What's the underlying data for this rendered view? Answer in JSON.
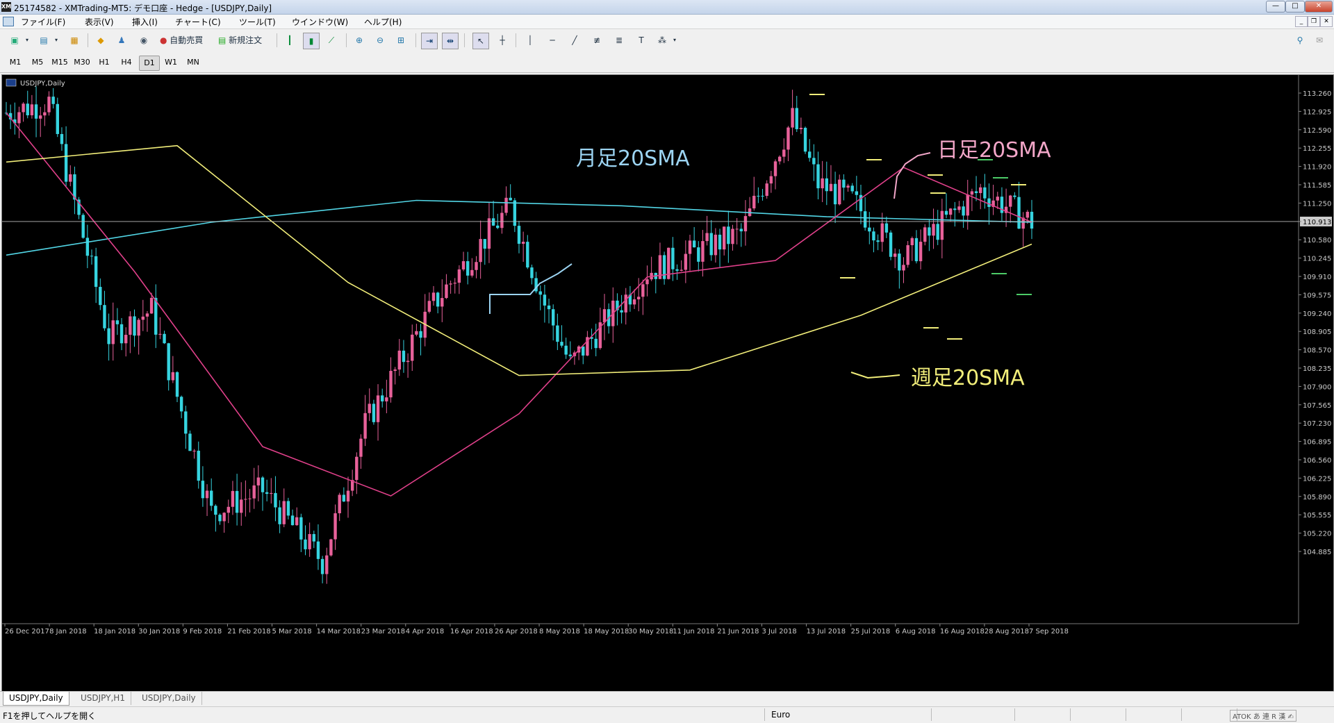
{
  "window": {
    "title": "25174582 - XMTrading-MT5: デモ口座 - Hedge - [USDJPY,Daily]",
    "logo": "XM",
    "controls": [
      "—",
      "□",
      "✕"
    ]
  },
  "menu": [
    "ファイル(F)",
    "表示(V)",
    "挿入(I)",
    "チャート(C)",
    "ツール(T)",
    "ウインドウ(W)",
    "ヘルプ(H)"
  ],
  "toolbar": {
    "auto_trade": "自動売買",
    "new_order": "新規注文"
  },
  "timeframes": [
    "M1",
    "M5",
    "M15",
    "M30",
    "H1",
    "H4",
    "D1",
    "W1",
    "MN"
  ],
  "active_timeframe": "D1",
  "chart": {
    "symbol_label": "USDJPY,Daily",
    "current_price": "110.913",
    "price_ticks": [
      "113.260",
      "112.925",
      "112.590",
      "112.255",
      "111.920",
      "111.585",
      "111.250",
      "110.913",
      "110.580",
      "110.245",
      "109.910",
      "109.575",
      "109.240",
      "108.905",
      "108.570",
      "108.235",
      "107.900",
      "107.565",
      "107.230",
      "106.895",
      "106.560",
      "106.225",
      "105.890",
      "105.555",
      "105.220",
      "104.885"
    ],
    "date_ticks": [
      "26 Dec 2017",
      "8 Jan 2018",
      "18 Jan 2018",
      "30 Jan 2018",
      "9 Feb 2018",
      "21 Feb 2018",
      "5 Mar 2018",
      "14 Mar 2018",
      "23 Mar 2018",
      "4 Apr 2018",
      "16 Apr 2018",
      "26 Apr 2018",
      "8 May 2018",
      "18 May 2018",
      "30 May 2018",
      "11 Jun 2018",
      "21 Jun 2018",
      "3 Jul 2018",
      "13 Jul 2018",
      "25 Jul 2018",
      "6 Aug 2018",
      "16 Aug 2018",
      "28 Aug 2018",
      "7 Sep 2018"
    ],
    "annotations": {
      "monthly": "月足20SMA",
      "daily": "日足20SMA",
      "weekly": "週足20SMA"
    },
    "colors": {
      "background": "#000000",
      "bull": "#e8619a",
      "bear": "#36d4e0",
      "sma_daily": "#e0408a",
      "sma_weekly": "#f2ee7a",
      "sma_monthly": "#52d6e6",
      "ann_monthly": "#9cd4f2",
      "ann_daily": "#f2a6c8",
      "ann_weekly": "#f2ee7a"
    }
  },
  "chart_data": {
    "type": "candlestick",
    "title": "USDJPY,Daily",
    "x_range": [
      "26 Dec 2017",
      "7 Sep 2018"
    ],
    "ylim": [
      104.7,
      113.4
    ],
    "current_price": 110.913,
    "key_points": [
      {
        "date": "8 Jan 2018",
        "close": 113.1
      },
      {
        "date": "30 Jan 2018",
        "close": 108.8
      },
      {
        "date": "26 Mar 2018",
        "low": 104.64
      },
      {
        "date": "21 May 2018",
        "high": 111.4
      },
      {
        "date": "29 May 2018",
        "low": 108.1
      },
      {
        "date": "19 Jul 2018",
        "high": 113.18
      },
      {
        "date": "21 Aug 2018",
        "low": 109.77
      },
      {
        "date": "7 Sep 2018",
        "close": 110.913
      }
    ],
    "series": [
      {
        "name": "月足20SMA",
        "values": [
          110.3,
          110.9,
          111.3,
          111.2,
          111.0,
          110.9
        ]
      },
      {
        "name": "日足20SMA",
        "values": [
          112.9,
          110.0,
          106.8,
          105.9,
          107.4,
          109.9,
          110.2,
          111.9,
          110.9
        ]
      },
      {
        "name": "週足20SMA",
        "values": [
          112.0,
          112.3,
          109.8,
          108.1,
          108.2,
          109.2,
          110.5
        ]
      }
    ]
  }
}
